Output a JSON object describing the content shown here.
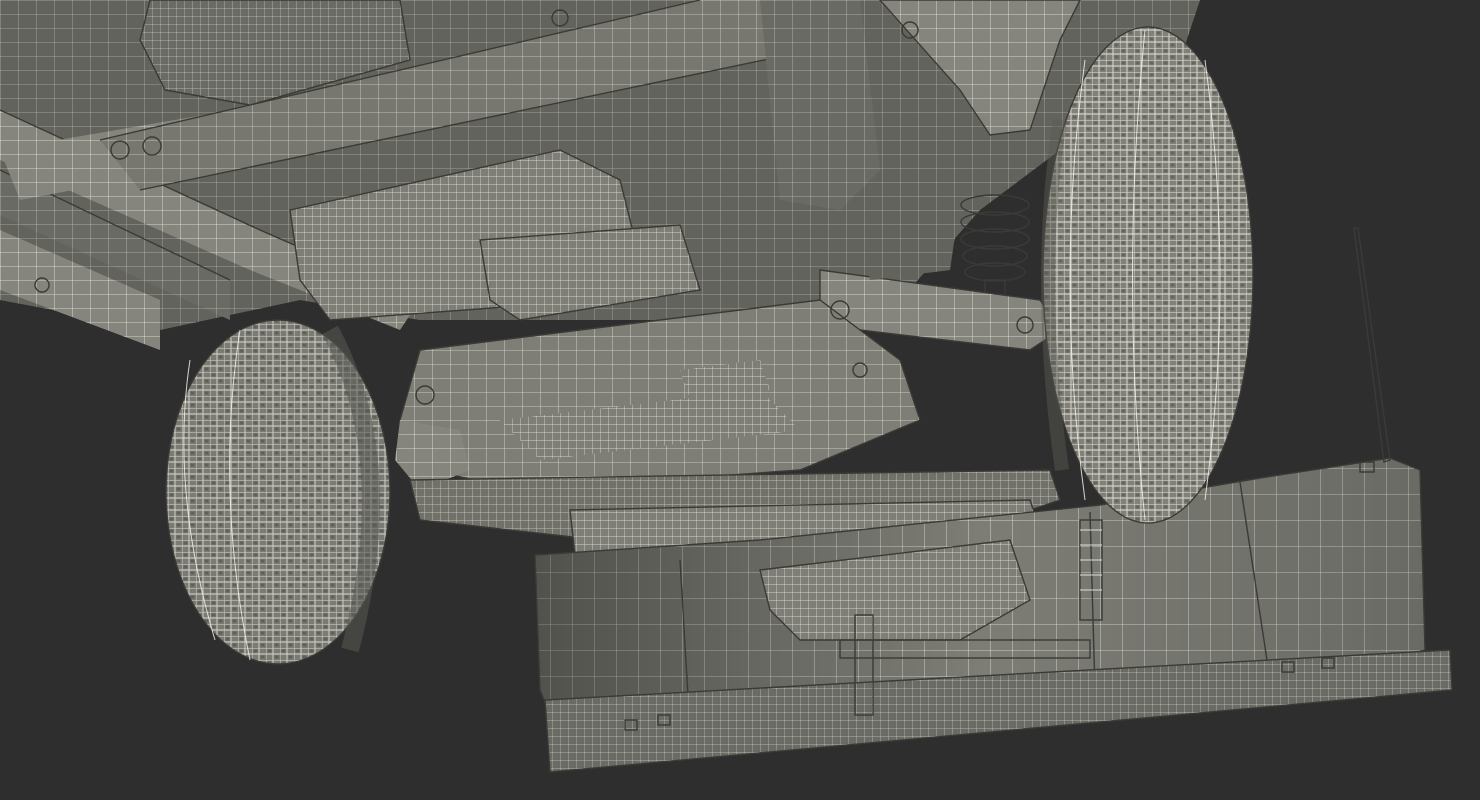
{
  "scene": {
    "background_color": "#2e2e2e",
    "mesh_fill_color": "#8a8a82",
    "mesh_shadow_color": "#55554f",
    "wire_color": "#f2f0e6"
  }
}
